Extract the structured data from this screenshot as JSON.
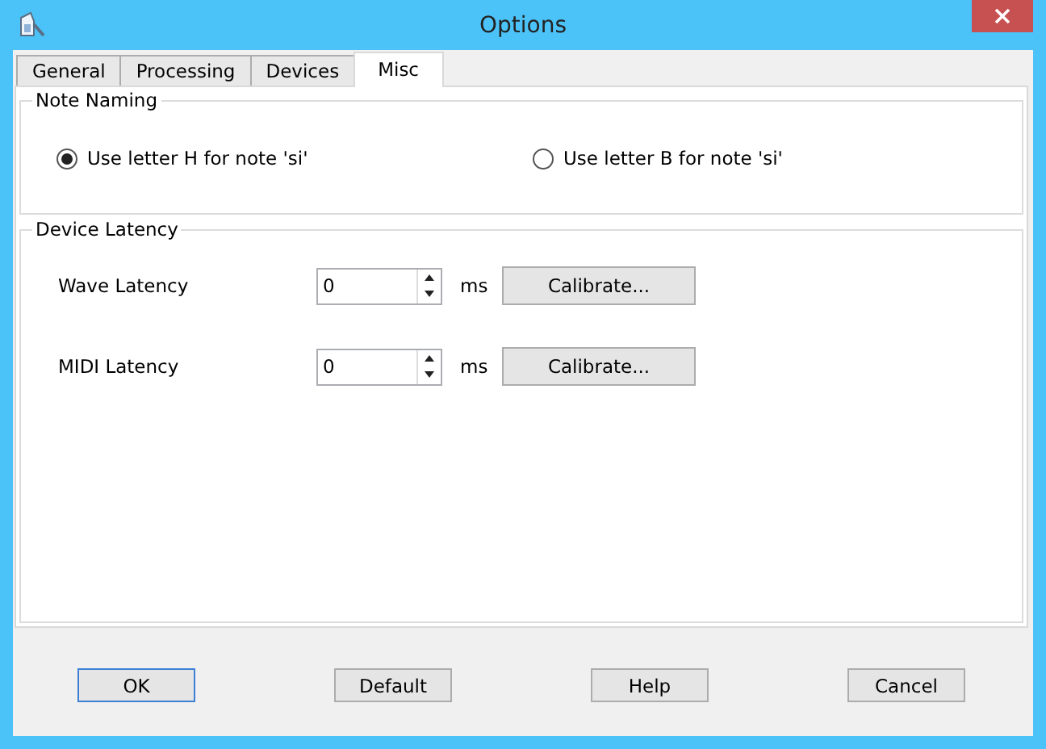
{
  "window": {
    "title": "Options"
  },
  "tabs": [
    {
      "label": "General",
      "selected": false
    },
    {
      "label": "Processing",
      "selected": false
    },
    {
      "label": "Devices",
      "selected": false
    },
    {
      "label": "Misc",
      "selected": true
    }
  ],
  "note_naming": {
    "title": "Note Naming",
    "options": [
      {
        "label": "Use letter H for note 'si'",
        "selected": true
      },
      {
        "label": "Use letter B for note 'si'",
        "selected": false
      }
    ]
  },
  "device_latency": {
    "title": "Device Latency",
    "rows": [
      {
        "label": "Wave Latency",
        "value": "0",
        "unit": "ms",
        "button": "Calibrate..."
      },
      {
        "label": "MIDI Latency",
        "value": "0",
        "unit": "ms",
        "button": "Calibrate..."
      }
    ]
  },
  "buttons": [
    {
      "label": "OK",
      "focused": true
    },
    {
      "label": "Default",
      "focused": false
    },
    {
      "label": "Help",
      "focused": false
    },
    {
      "label": "Cancel",
      "focused": false
    }
  ]
}
